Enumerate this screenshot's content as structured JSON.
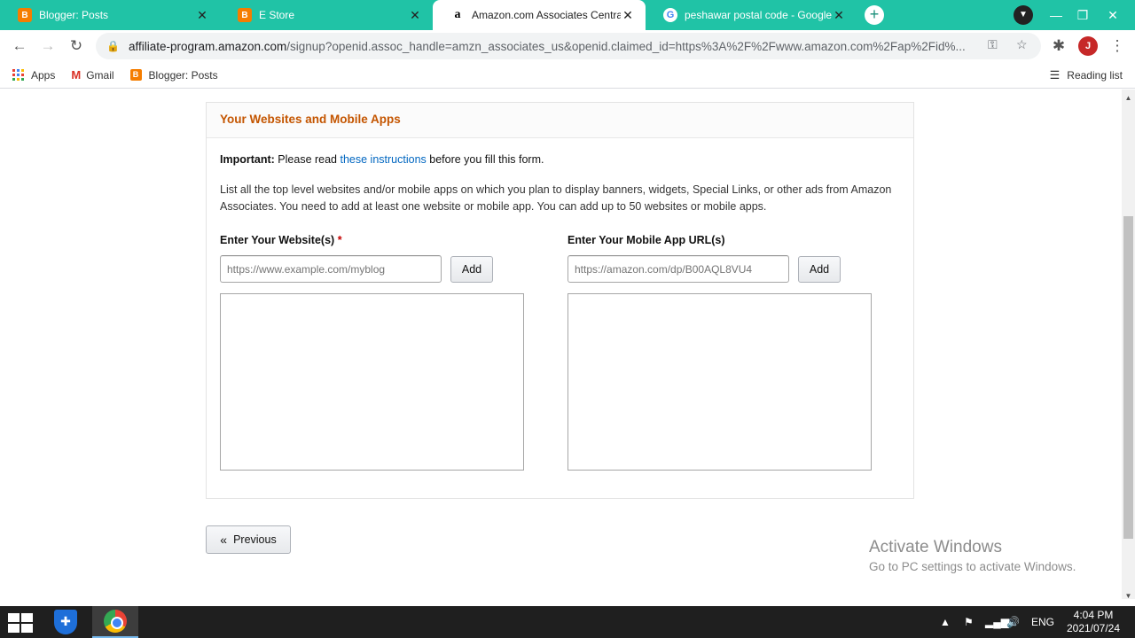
{
  "browser": {
    "tabs": [
      {
        "title": "Blogger: Posts",
        "favicon": "blogger-icon",
        "active": false
      },
      {
        "title": "E Store",
        "favicon": "blogger-icon",
        "active": false
      },
      {
        "title": "Amazon.com Associates Central",
        "favicon": "amazon-icon",
        "active": true
      },
      {
        "title": "peshawar postal code - Google S",
        "favicon": "google-icon",
        "active": false
      }
    ],
    "url_host": "affiliate-program.amazon.com",
    "url_path": "/signup?openid.assoc_handle=amzn_associates_us&openid.claimed_id=https%3A%2F%2Fwww.amazon.com%2Fap%2Fid%...",
    "profile_initial": "J",
    "bookmarks": [
      {
        "label": "Apps",
        "icon": "apps-grid-icon"
      },
      {
        "label": "Gmail",
        "icon": "gmail-icon"
      },
      {
        "label": "Blogger: Posts",
        "icon": "blogger-icon"
      }
    ],
    "reading_list": "Reading list"
  },
  "page": {
    "section_title": "Your Websites and Mobile Apps",
    "important_label": "Important:",
    "important_pre": "Please read",
    "important_link": "these instructions",
    "important_post": "before you fill this form.",
    "description": "List all the top level websites and/or mobile apps on which you plan to display banners, widgets, Special Links, or other ads from Amazon Associates. You need to add at least one website or mobile app. You can add up to 50 websites or mobile apps.",
    "websites": {
      "label": "Enter Your Website(s)",
      "required_mark": "*",
      "placeholder": "https://www.example.com/myblog",
      "add_label": "Add"
    },
    "apps": {
      "label": "Enter Your Mobile App URL(s)",
      "placeholder": "https://amazon.com/dp/B00AQL8VU4",
      "add_label": "Add"
    },
    "previous_label": "Previous"
  },
  "watermark": {
    "line1": "Activate Windows",
    "line2": "Go to PC settings to activate Windows."
  },
  "taskbar": {
    "language": "ENG",
    "time": "4:04 PM",
    "date": "2021/07/24"
  },
  "colors": {
    "tab_strip": "#20c3a6",
    "section_title": "#c45500",
    "link": "#0066c0",
    "required": "#c40000"
  }
}
